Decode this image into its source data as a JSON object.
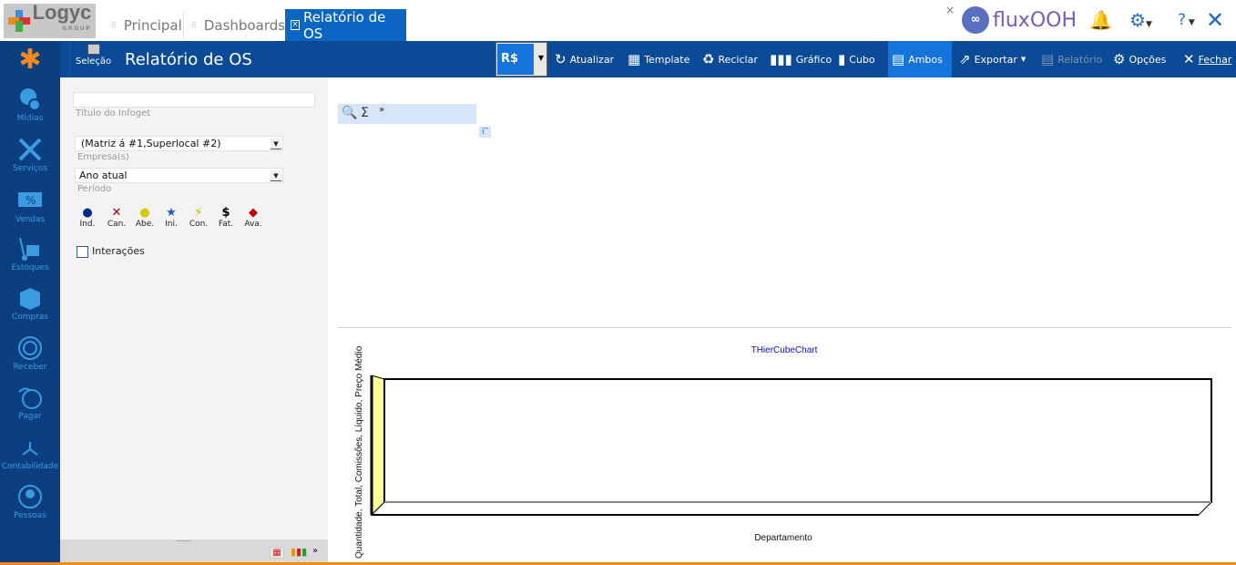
{
  "logo": {
    "name": "Logyc",
    "sub": "GROUP"
  },
  "tabs": [
    {
      "label": "Principal"
    },
    {
      "label": "Dashboards"
    },
    {
      "label": "Relatório de OS",
      "active": true
    }
  ],
  "header_right": {
    "brand": "fluxOOH"
  },
  "page": {
    "selection_label": "Seleção",
    "title": "Relatório de OS"
  },
  "toolbar": {
    "currency": "R$",
    "items": [
      {
        "label": "Atualizar",
        "icon": "refresh-icon"
      },
      {
        "label": "Template",
        "icon": "template-icon"
      },
      {
        "label": "Reciclar",
        "icon": "recycle-icon"
      },
      {
        "label": "Gráfico",
        "icon": "chart-icon"
      },
      {
        "label": "Cubo",
        "icon": "cube-icon"
      },
      {
        "label": "Ambos",
        "icon": "both-icon",
        "active": true
      },
      {
        "label": "Exportar",
        "icon": "export-icon"
      },
      {
        "label": "Relatório",
        "icon": "report-icon",
        "disabled": true
      },
      {
        "label": "Opções",
        "icon": "gear-icon"
      },
      {
        "label": "Fechar",
        "icon": "close-icon"
      }
    ]
  },
  "sidebar": [
    {
      "label": "Mídias"
    },
    {
      "label": "Serviços"
    },
    {
      "label": "Vendas"
    },
    {
      "label": "Estoques"
    },
    {
      "label": "Compras"
    },
    {
      "label": "Receber"
    },
    {
      "label": "Pagar"
    },
    {
      "label": "Contabilidade"
    },
    {
      "label": "Pessoas"
    }
  ],
  "filters": {
    "title_value": "",
    "title_label": "Título do Infoget",
    "company_value": "(Matriz á #1,Superlocal #2)",
    "company_label": "Empresa(s)",
    "period_value": "Ano atual",
    "period_label": "Período",
    "statuses": [
      {
        "label": "Ind.",
        "color": "#0a2a8a"
      },
      {
        "label": "Can.",
        "color": "#a00000"
      },
      {
        "label": "Abe.",
        "color": "#e8d800"
      },
      {
        "label": "Ini.",
        "color": "#1a5fd0"
      },
      {
        "label": "Con.",
        "color": "#d8c000"
      },
      {
        "label": "Fat.",
        "color": "#000000"
      },
      {
        "label": "Ava.",
        "color": "#c00000"
      }
    ],
    "interactions_label": "Interações",
    "interactions_checked": false
  },
  "chart_data": {
    "type": "bar",
    "title": "THierCubeChart",
    "xlabel": "Departamento",
    "ylabel": "Quantidade, Total, Comissões, Líquido, Preço Médio",
    "categories": [],
    "series": []
  },
  "colors": {
    "accent": "#0b4a96",
    "active": "#1474dc",
    "sidebar": "#0b3f80",
    "bottom_bar": "#f08a1c",
    "chart_wall": "#ffff99"
  }
}
